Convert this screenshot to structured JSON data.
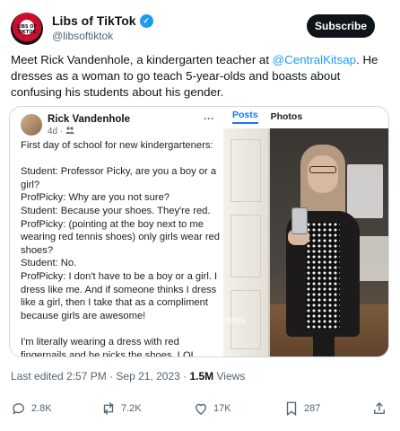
{
  "tweet": {
    "display_name": "Libs of TikTok",
    "handle": "@libsoftiktok",
    "avatar_text": "LIBS OF TIKTOK",
    "subscribe_label": "Subscribe",
    "text_before": "Meet Rick Vandenhole, a kindergarten teacher at ",
    "mention": "@CentralKitsap",
    "text_after": ". He dresses as a woman to go teach 5-year-olds and boasts about confusing his students about his gender."
  },
  "embed": {
    "author": "Rick Vandenhole",
    "meta": "4d · ",
    "more": "···",
    "tabs": [
      "Posts",
      "Photos"
    ],
    "watermark": "@libsoftiktok",
    "post_lines": [
      "First day of school for new kindergarteners:",
      "",
      "Student:  Professor Picky, are you a boy or a girl?",
      "ProfPicky: Why are you not sure?",
      "Student:  Because your shoes.  They're red.",
      "ProfPicky: (pointing at the boy next to me wearing red tennis shoes) only girls wear red shoes?",
      "Student: No.",
      "ProfPicky: I don't have to be a boy or a girl. I dress like me.  And if someone thinks I dress like a girl, then I take that as a compliment because girls are awesome!",
      "",
      "I'm literally wearing a dress with red fingernails and he picks the shoes.  LOL"
    ]
  },
  "footer": {
    "last_edited": "Last edited 2:57 PM · Sep 21, 2023 · ",
    "views_count": "1.5M",
    "views_label": " Views"
  },
  "actions": {
    "replies": "2.8K",
    "reposts": "7.2K",
    "likes": "17K",
    "bookmarks": "287"
  },
  "icons": [
    "verified-badge-icon",
    "privacy-friends-icon",
    "reply-icon",
    "repost-icon",
    "like-icon",
    "bookmark-icon",
    "share-icon"
  ],
  "colors": {
    "accent": "#1d9bf0",
    "facebook_blue": "#1877f2",
    "secondary_text": "#536471"
  }
}
